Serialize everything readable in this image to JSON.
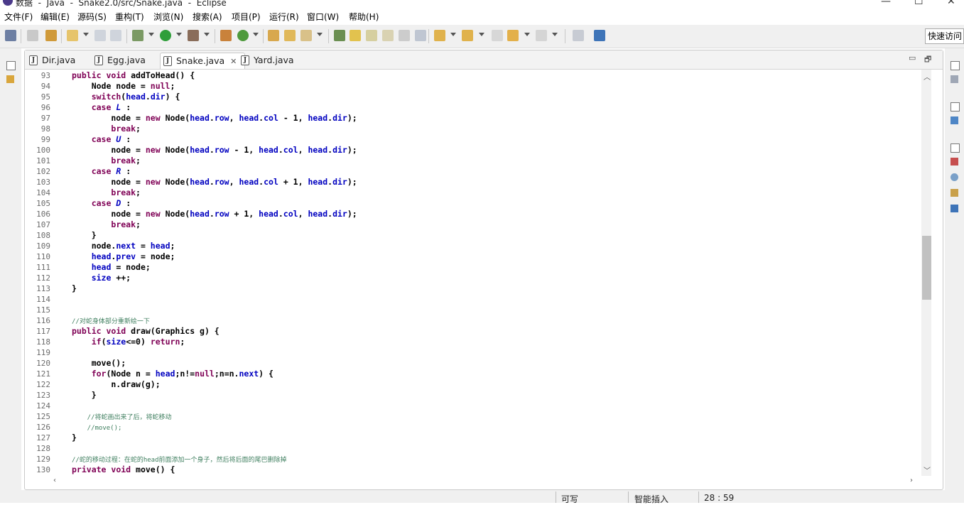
{
  "window": {
    "title": "数据  -  Java  -  Snake2.0/src/Snake.java  -  Eclipse",
    "controls": [
      "—",
      "☐",
      "✕"
    ]
  },
  "menu": [
    "文件(F)",
    "编辑(E)",
    "源码(S)",
    "重构(T)",
    "浏览(N)",
    "搜索(A)",
    "项目(P)",
    "运行(R)",
    "窗口(W)",
    "帮助(H)"
  ],
  "toolbar": {
    "quick_access": "快速访问"
  },
  "tabs": [
    {
      "label": "Dir.java",
      "active": false
    },
    {
      "label": "Egg.java",
      "active": false
    },
    {
      "label": "Snake.java",
      "active": true
    },
    {
      "label": "Yard.java",
      "active": false
    }
  ],
  "tab_close": "✕",
  "view_controls": {
    "minimize": "▭",
    "maximize": "🗗"
  },
  "code": [
    {
      "n": "93",
      "t": "public void addToHead() {"
    },
    {
      "n": "94",
      "t": "    Node node = null;"
    },
    {
      "n": "95",
      "t": "    switch(head.dir) {"
    },
    {
      "n": "96",
      "t": "    case L :"
    },
    {
      "n": "97",
      "t": "        node = new Node(head.row, head.col - 1, head.dir);"
    },
    {
      "n": "98",
      "t": "        break;"
    },
    {
      "n": "99",
      "t": "    case U :"
    },
    {
      "n": "100",
      "t": "        node = new Node(head.row - 1, head.col, head.dir);"
    },
    {
      "n": "101",
      "t": "        break;"
    },
    {
      "n": "102",
      "t": "    case R :"
    },
    {
      "n": "103",
      "t": "        node = new Node(head.row, head.col + 1, head.dir);"
    },
    {
      "n": "104",
      "t": "        break;"
    },
    {
      "n": "105",
      "t": "    case D :"
    },
    {
      "n": "106",
      "t": "        node = new Node(head.row + 1, head.col, head.dir);"
    },
    {
      "n": "107",
      "t": "        break;"
    },
    {
      "n": "108",
      "t": "    }"
    },
    {
      "n": "109",
      "t": "    node.next = head;"
    },
    {
      "n": "110",
      "t": "    head.prev = node;"
    },
    {
      "n": "111",
      "t": "    head = node;"
    },
    {
      "n": "112",
      "t": "    size ++;"
    },
    {
      "n": "113",
      "t": "}"
    },
    {
      "n": "114",
      "t": ""
    },
    {
      "n": "115",
      "t": ""
    },
    {
      "n": "116",
      "t": "//对蛇身体部分重新绘一下"
    },
    {
      "n": "117",
      "t": "public void draw(Graphics g) {"
    },
    {
      "n": "118",
      "t": "    if(size<=0) return;"
    },
    {
      "n": "119",
      "t": ""
    },
    {
      "n": "120",
      "t": "    move();"
    },
    {
      "n": "121",
      "t": "    for(Node n = head;n!=null;n=n.next) {"
    },
    {
      "n": "122",
      "t": "        n.draw(g);"
    },
    {
      "n": "123",
      "t": "    }"
    },
    {
      "n": "124",
      "t": ""
    },
    {
      "n": "125",
      "t": "    //将蛇画出来了后，将蛇移动"
    },
    {
      "n": "126",
      "t": "    //move();"
    },
    {
      "n": "127",
      "t": "}"
    },
    {
      "n": "128",
      "t": ""
    },
    {
      "n": "129",
      "t": "//蛇的移动过程：在蛇的head前面添加一个身子，然后将后面的尾巴删除掉"
    },
    {
      "n": "130",
      "t": "private void move() {"
    }
  ],
  "status": {
    "writable": "可写",
    "insert_mode": "智能插入",
    "position": "28 : 59"
  },
  "colors": {
    "keyword": "#7f0055",
    "field": "#0000c0",
    "comment": "#3f7f5f",
    "line_number": "#6b6b6b"
  }
}
